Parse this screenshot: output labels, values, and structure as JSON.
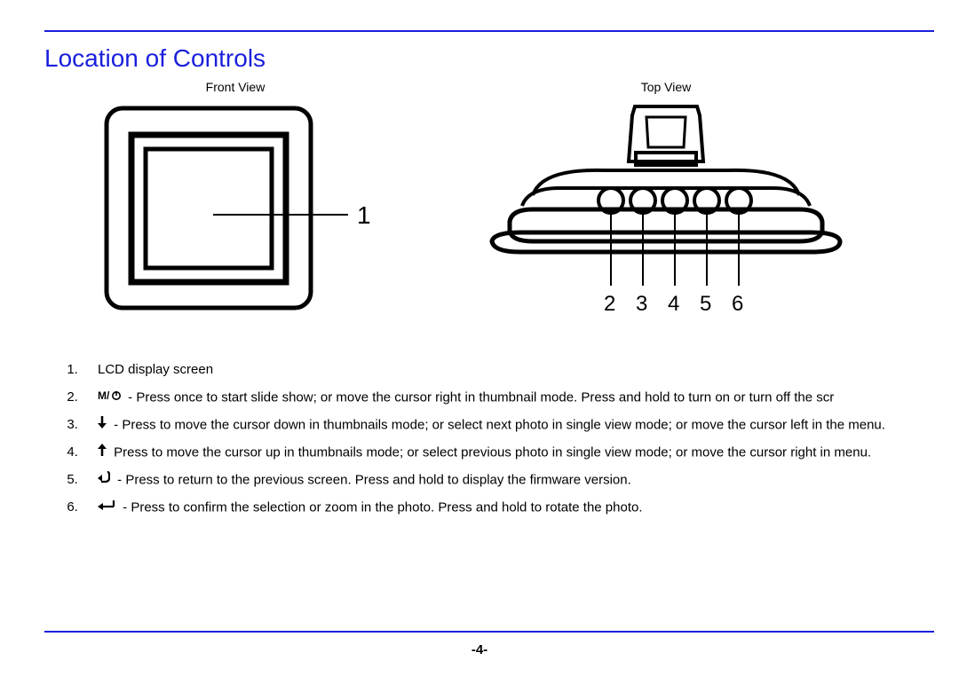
{
  "heading": "Location of Controls",
  "front_label": "Front View",
  "top_label": "Top View",
  "top_callouts": [
    "2",
    "3",
    "4",
    "5",
    "6"
  ],
  "front_callout": "1",
  "items": {
    "i1": "LCD display screen",
    "i2_pre": "",
    "i2": " - Press once to start slide show; or move the cursor right in thumbnail mode. Press and hold to turn on or turn off the scr",
    "i3": " - Press to move the cursor down in thumbnails mode; or select next photo in single view mode; or move the cursor left in the menu.",
    "i4": "  Press to move the cursor up in thumbnails mode; or select previous photo in single view mode; or move the cursor right in menu.",
    "i5": " - Press to return to the previous screen. Press and hold to display the firmware version.",
    "i6": " - Press to confirm the selection or zoom in the photo. Press and hold to rotate the photo."
  },
  "page_number": "-4-"
}
